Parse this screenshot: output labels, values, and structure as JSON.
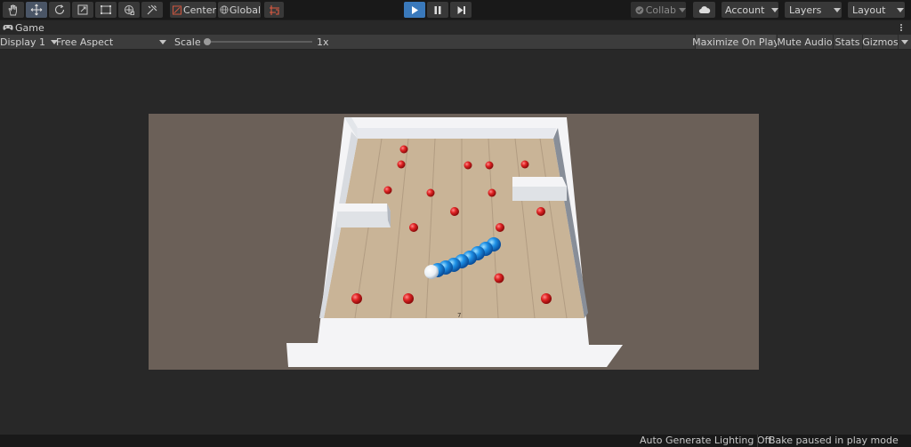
{
  "toolbar": {
    "tools": [
      {
        "name": "hand-tool",
        "icon": "hand-icon",
        "active": false
      },
      {
        "name": "move-tool",
        "icon": "move-icon",
        "active": true
      },
      {
        "name": "rotate-tool",
        "icon": "rotate-icon",
        "active": false
      },
      {
        "name": "scale-tool",
        "icon": "scale-icon",
        "active": false
      },
      {
        "name": "rect-tool",
        "icon": "rect-icon",
        "active": false
      },
      {
        "name": "transform-tool",
        "icon": "transform-icon",
        "active": false
      },
      {
        "name": "custom-tool",
        "icon": "custom-tool-icon",
        "active": false
      }
    ],
    "pivot_label": "Center",
    "space_label": "Global",
    "collab_label": "Collab",
    "account_label": "Account",
    "layers_label": "Layers",
    "layout_label": "Layout",
    "play_active_color": "#3a79bb"
  },
  "tab": {
    "label": "Game"
  },
  "game_view": {
    "display_label": "Display 1",
    "aspect_label": "Free Aspect",
    "scale_label": "Scale",
    "scale_value": "1x",
    "scale_slider_fraction": 0.0,
    "maximize_label": "Maximize On Play",
    "mute_label": "Mute Audio",
    "stats_label": "Stats",
    "gizmos_label": "Gizmos"
  },
  "game": {
    "score_text": "7",
    "ball_color": "#e02424",
    "snake_color": "#1e90e6",
    "wall_color": "#f4f4f6",
    "floor_color": "#c9b497",
    "background_color": "#6b6058"
  },
  "status": {
    "lighting_label": "Auto Generate Lighting Off",
    "bake_label": "Bake paused in play mode"
  }
}
